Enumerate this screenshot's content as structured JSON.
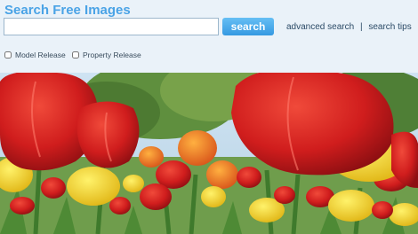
{
  "header": {
    "title": "Search Free Images"
  },
  "search": {
    "value": "",
    "button_label": "search"
  },
  "links": {
    "advanced": "advanced search",
    "separator": "|",
    "tips": "search tips"
  },
  "filters": {
    "model_release": {
      "label": "Model Release",
      "checked": false
    },
    "property_release": {
      "label": "Property Release",
      "checked": false
    }
  },
  "photo": {
    "subject": "tulip field photo"
  },
  "colors": {
    "title": "#4aa3e6",
    "button": "#3599e2",
    "background": "#eaf2f9"
  }
}
